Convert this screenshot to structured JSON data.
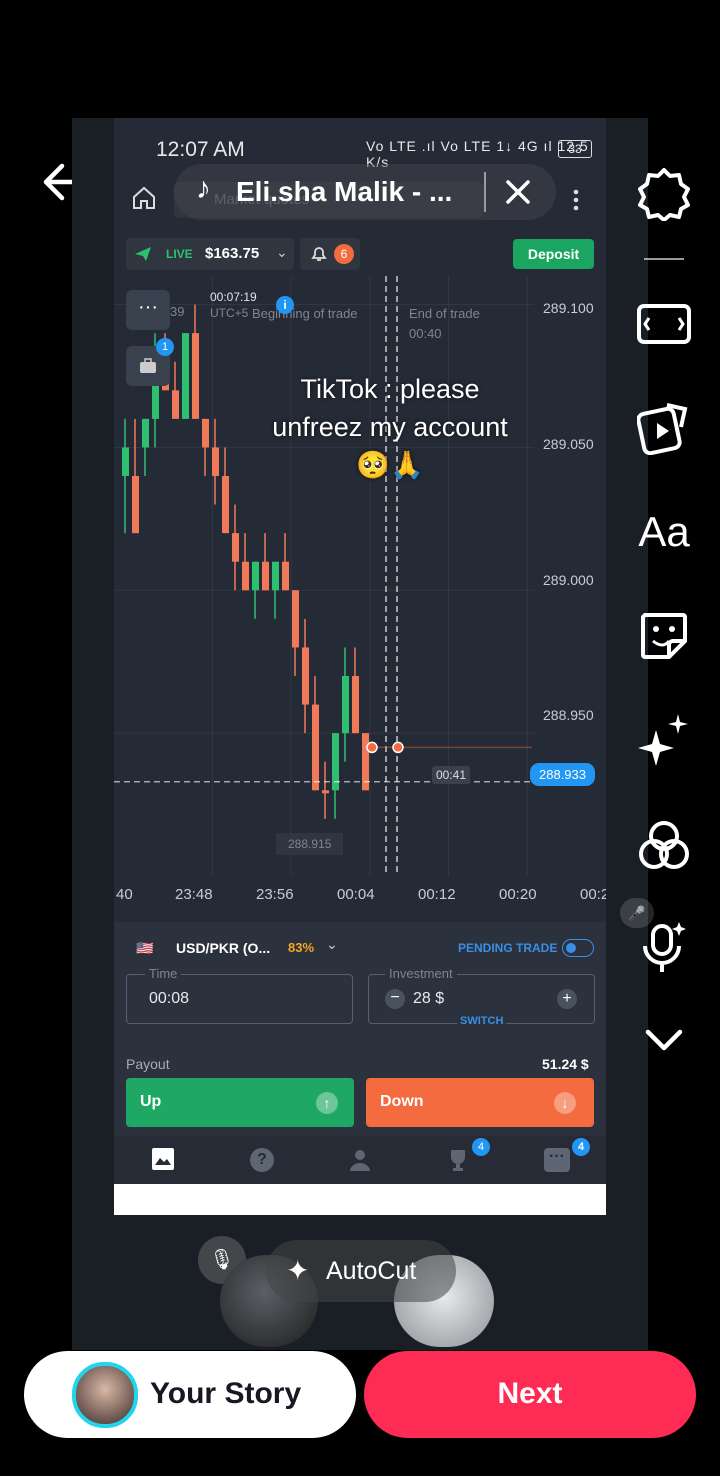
{
  "music_bar": {
    "title": "Eli.sha Malik - ..."
  },
  "caption": {
    "line1": "TikTok : please",
    "line2": "unfreez my account",
    "emoji": "🥺🙏"
  },
  "phone_status": {
    "time": "12:07 AM",
    "icons": "Vo LTE .ıl Vo LTE 1↓ 4G ıl 12.5 K/s",
    "battery": "33"
  },
  "app_header": {
    "search_placeholder": "Market quotes"
  },
  "account": {
    "mode": "LIVE",
    "balance": "$163.75",
    "notifications": "6",
    "deposit_label": "Deposit"
  },
  "chart_overlay": {
    "menu_badge": "1",
    "timer": "00:07:19",
    "utc": "UTC+5",
    "begin_label": "Beginning of trade",
    "end_label": "End of trade",
    "end_time": "00:40",
    "left_clip": "39",
    "countdown": "00:41",
    "current_price": "288.933",
    "low_price": "288.915"
  },
  "chart_data": {
    "type": "candlestick",
    "y_ticks": [
      "289.100",
      "289.050",
      "289.000",
      "288.950"
    ],
    "x_ticks": [
      "40",
      "23:48",
      "23:56",
      "00:04",
      "00:12",
      "00:20",
      "00:2"
    ],
    "ylim": [
      288.9,
      289.11
    ],
    "current_price": 288.933,
    "candles": [
      {
        "o": 289.04,
        "h": 289.06,
        "l": 289.02,
        "c": 289.05,
        "dir": "up"
      },
      {
        "o": 289.02,
        "h": 289.06,
        "l": 289.02,
        "c": 289.04,
        "dir": "down"
      },
      {
        "o": 289.05,
        "h": 289.06,
        "l": 289.04,
        "c": 289.06,
        "dir": "up"
      },
      {
        "o": 289.06,
        "h": 289.09,
        "l": 289.05,
        "c": 289.08,
        "dir": "up"
      },
      {
        "o": 289.08,
        "h": 289.09,
        "l": 289.07,
        "c": 289.07,
        "dir": "down"
      },
      {
        "o": 289.07,
        "h": 289.08,
        "l": 289.06,
        "c": 289.06,
        "dir": "down"
      },
      {
        "o": 289.06,
        "h": 289.09,
        "l": 289.06,
        "c": 289.09,
        "dir": "up"
      },
      {
        "o": 289.09,
        "h": 289.1,
        "l": 289.06,
        "c": 289.06,
        "dir": "down"
      },
      {
        "o": 289.06,
        "h": 289.06,
        "l": 289.04,
        "c": 289.05,
        "dir": "down"
      },
      {
        "o": 289.05,
        "h": 289.06,
        "l": 289.03,
        "c": 289.04,
        "dir": "down"
      },
      {
        "o": 289.04,
        "h": 289.05,
        "l": 289.02,
        "c": 289.02,
        "dir": "down"
      },
      {
        "o": 289.02,
        "h": 289.03,
        "l": 289.0,
        "c": 289.01,
        "dir": "down"
      },
      {
        "o": 289.01,
        "h": 289.02,
        "l": 289.0,
        "c": 289.0,
        "dir": "down"
      },
      {
        "o": 289.0,
        "h": 289.01,
        "l": 288.99,
        "c": 289.01,
        "dir": "up"
      },
      {
        "o": 289.01,
        "h": 289.02,
        "l": 289.0,
        "c": 289.0,
        "dir": "down"
      },
      {
        "o": 289.0,
        "h": 289.01,
        "l": 288.99,
        "c": 289.01,
        "dir": "up"
      },
      {
        "o": 289.01,
        "h": 289.02,
        "l": 289.0,
        "c": 289.0,
        "dir": "down"
      },
      {
        "o": 289.0,
        "h": 289.0,
        "l": 288.97,
        "c": 288.98,
        "dir": "down"
      },
      {
        "o": 288.98,
        "h": 288.99,
        "l": 288.95,
        "c": 288.96,
        "dir": "down"
      },
      {
        "o": 288.96,
        "h": 288.97,
        "l": 288.93,
        "c": 288.93,
        "dir": "down"
      },
      {
        "o": 288.93,
        "h": 288.94,
        "l": 288.92,
        "c": 288.93,
        "dir": "down"
      },
      {
        "o": 288.93,
        "h": 288.95,
        "l": 288.92,
        "c": 288.95,
        "dir": "up"
      },
      {
        "o": 288.95,
        "h": 288.98,
        "l": 288.94,
        "c": 288.97,
        "dir": "up"
      },
      {
        "o": 288.97,
        "h": 288.98,
        "l": 288.95,
        "c": 288.95,
        "dir": "down"
      },
      {
        "o": 288.95,
        "h": 288.95,
        "l": 288.93,
        "c": 288.93,
        "dir": "down"
      }
    ]
  },
  "trade_panel": {
    "pair": "USD/PKR (O...",
    "payout_pct": "83%",
    "pending_label": "PENDING TRADE",
    "time_label": "Time",
    "time_value": "00:08",
    "investment_label": "Investment",
    "investment_value": "28 $",
    "switch_label": "SWITCH",
    "payout_label": "Payout",
    "payout_value": "51.24 $",
    "up_label": "Up",
    "down_label": "Down"
  },
  "bottom_nav": {
    "badge_trophy": "4",
    "badge_chat": "4"
  },
  "editor": {
    "autocut_label": "AutoCut",
    "your_story_label": "Your Story",
    "next_label": "Next"
  },
  "colors": {
    "green": "#1fa864",
    "red": "#f36b3e",
    "next": "#fe2c55",
    "deposit": "#1aa561",
    "candle_up": "#2fbf71",
    "candle_down": "#f0795a"
  }
}
